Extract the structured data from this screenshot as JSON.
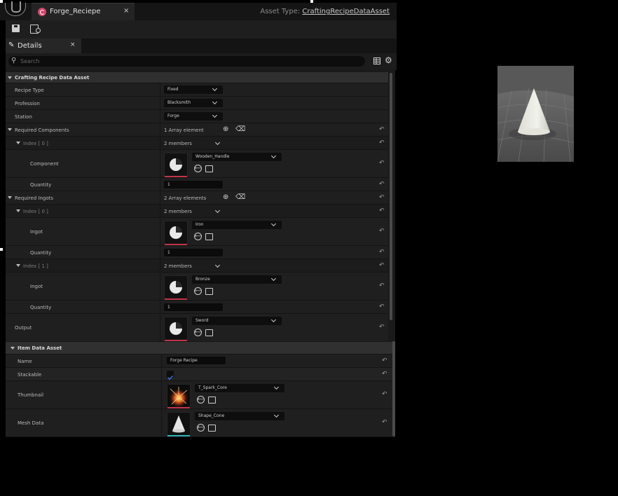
{
  "window": {
    "tab_label": "Forge_Reciepe",
    "tab_close": "×",
    "asset_type_label": "Asset Type:",
    "asset_type_value": "CraftingRecipeDataAsset"
  },
  "details": {
    "tab_label": "Details",
    "tab_close": "×",
    "search_placeholder": "Search"
  },
  "crafting_recipe": {
    "header": "Crafting Recipe Data Asset",
    "recipe_type_label": "Recipe Type",
    "recipe_type_value": "Fixed",
    "profession_label": "Profession",
    "profession_value": "Blacksmith",
    "station_label": "Station",
    "station_value": "Forge",
    "required_components": {
      "label": "Required Components",
      "count": "1 Array element",
      "index0": {
        "label": "Index [ 0 ]",
        "members": "2 members",
        "component_label": "Component",
        "component_value": "Wooden_Handle",
        "quantity_label": "Quantity",
        "quantity_value": "1"
      }
    },
    "required_ingots": {
      "label": "Required Ingots",
      "count": "2 Array elements",
      "index0": {
        "label": "Index [ 0 ]",
        "members": "2 members",
        "ingot_label": "Ingot",
        "ingot_value": "Iron",
        "quantity_label": "Quantity",
        "quantity_value": "1"
      },
      "index1": {
        "label": "Index [ 1 ]",
        "members": "2 members",
        "ingot_label": "Ingot",
        "ingot_value": "Bronze",
        "quantity_label": "Quantity",
        "quantity_value": "1"
      }
    },
    "output_label": "Output",
    "output_value": "Sword"
  },
  "item_data": {
    "header": "Item Data Asset",
    "name_label": "Name",
    "name_value": "Forge Recipe",
    "stackable_label": "Stackable",
    "stackable_checked": true,
    "thumbnail_label": "Thumbnail",
    "thumbnail_value": "T_Spark_Core",
    "mesh_label": "Mesh Data",
    "mesh_value": "Shape_Cone"
  },
  "icons": {
    "reset": "↶",
    "add": "⊕",
    "delete": "🗑",
    "use_selected": "⟵",
    "search": "search-icon",
    "settings": "⚙"
  },
  "colors": {
    "asset_accent": "#d2456a",
    "texture_accent": "#c0354a",
    "mesh_accent": "#2fb5b5",
    "checkbox": "#1e5aa8"
  }
}
